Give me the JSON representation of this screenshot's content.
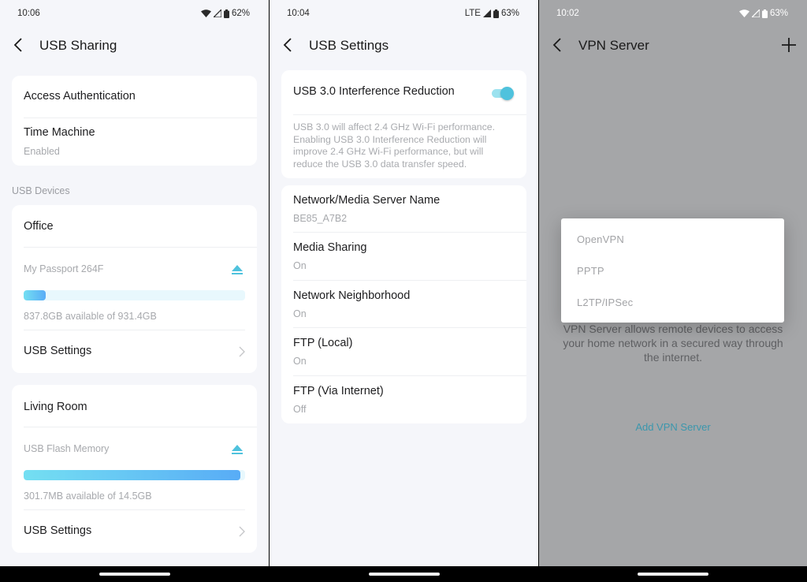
{
  "colors": {
    "accent": "#4fc2dd",
    "link": "#3b97ad",
    "bar_start": "#74dff2",
    "bar_end": "#58acf6",
    "page_bg": "#f5f6fa",
    "scrim_bg": "#a5a6a8"
  },
  "screens": [
    {
      "status": {
        "time": "10:06",
        "network": "wifi",
        "signal": "cellular-signal",
        "battery": "62%"
      },
      "appbar": {
        "title": "USB Sharing",
        "back_icon": "chevron-left-icon"
      },
      "top_card": {
        "items": [
          {
            "label": "Access Authentication"
          },
          {
            "label": "Time Machine",
            "value": "Enabled"
          }
        ]
      },
      "section_label": "USB Devices",
      "devices": [
        {
          "location": "Office",
          "drive_name": "My Passport 264F",
          "eject_icon": "eject-icon",
          "used_fraction": 0.1,
          "capacity_text": "837.8GB available of 931.4GB",
          "settings_label": "USB Settings"
        },
        {
          "location": "Living Room",
          "drive_name": "USB Flash Memory",
          "eject_icon": "eject-icon",
          "used_fraction": 0.98,
          "capacity_text": "301.7MB available of 14.5GB",
          "settings_label": "USB Settings"
        }
      ]
    },
    {
      "status": {
        "time": "10:04",
        "network": "LTE",
        "signal": "cellular-signal",
        "battery": "63%"
      },
      "appbar": {
        "title": "USB Settings",
        "back_icon": "chevron-left-icon"
      },
      "interference": {
        "label": "USB 3.0 Interference Reduction",
        "enabled": true,
        "description": "USB 3.0 will affect 2.4 GHz Wi-Fi performance. Enabling USB 3.0 Interference Reduction will improve 2.4 GHz Wi-Fi performance, but will reduce the USB 3.0 data transfer speed."
      },
      "settings": [
        {
          "label": "Network/Media Server Name",
          "value": "BE85_A7B2"
        },
        {
          "label": "Media Sharing",
          "value": "On"
        },
        {
          "label": "Network Neighborhood",
          "value": "On"
        },
        {
          "label": "FTP (Local)",
          "value": "On"
        },
        {
          "label": "FTP (Via Internet)",
          "value": "Off"
        }
      ]
    },
    {
      "status": {
        "time": "10:02",
        "network": "wifi",
        "signal": "cellular-signal",
        "battery": "63%"
      },
      "appbar": {
        "title": "VPN Server",
        "back_icon": "chevron-left-icon",
        "action_icon": "plus-icon"
      },
      "description": "VPN Server allows remote devices to access your home network in a secured way through the internet.",
      "add_label": "Add VPN Server",
      "menu": {
        "options": [
          "OpenVPN",
          "PPTP",
          "L2TP/IPSec"
        ]
      }
    }
  ]
}
